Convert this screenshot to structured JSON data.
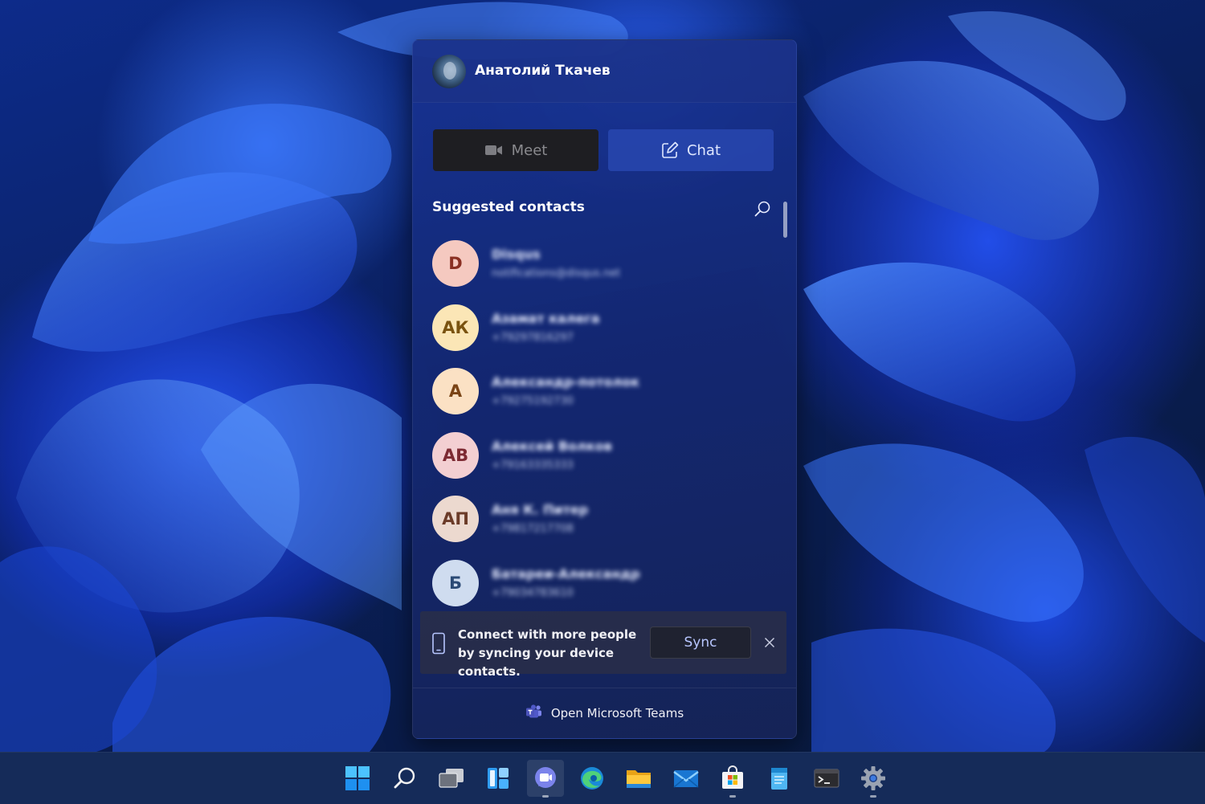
{
  "user": {
    "name": "Анатолий Ткачев"
  },
  "actions": {
    "meet_label": "Meet",
    "chat_label": "Chat"
  },
  "contacts_section": {
    "title": "Suggested contacts"
  },
  "contacts": [
    {
      "initials": "D",
      "name": "Disqus",
      "detail": "notifications@disqus.net",
      "bg": "#f5c9c0",
      "fg": "#8a2f22"
    },
    {
      "initials": "АК",
      "name": "Азамат калега",
      "detail": "+79297816297",
      "bg": "#fbe6b6",
      "fg": "#7a5310"
    },
    {
      "initials": "А",
      "name": "Александр-потолок",
      "detail": "+79275192730",
      "bg": "#fbe1c4",
      "fg": "#7a4416"
    },
    {
      "initials": "АВ",
      "name": "Алексей Волков",
      "detail": "+79163335333",
      "bg": "#f3cfd2",
      "fg": "#7d2a33"
    },
    {
      "initials": "АП",
      "name": "Аня К. Питер",
      "detail": "+79817217708",
      "bg": "#ecd9cf",
      "fg": "#6b3b28"
    },
    {
      "initials": "Б",
      "name": "Батареи-Александр",
      "detail": "+79034783610",
      "bg": "#cfdcef",
      "fg": "#2b4a75"
    }
  ],
  "sync": {
    "message": "Connect with more people by syncing your device contacts.",
    "button_label": "Sync"
  },
  "footer": {
    "label": "Open Microsoft Teams"
  },
  "taskbar": {
    "icons": [
      "start-icon",
      "search-icon",
      "task-view-icon",
      "widgets-icon",
      "teams-chat-icon",
      "edge-icon",
      "file-explorer-icon",
      "mail-icon",
      "store-icon",
      "notepad-icon",
      "terminal-icon",
      "settings-icon"
    ],
    "active": "teams-chat-icon"
  },
  "colors": {
    "accent": "#2f5ad8",
    "sync_text": "#b7c6ff"
  }
}
